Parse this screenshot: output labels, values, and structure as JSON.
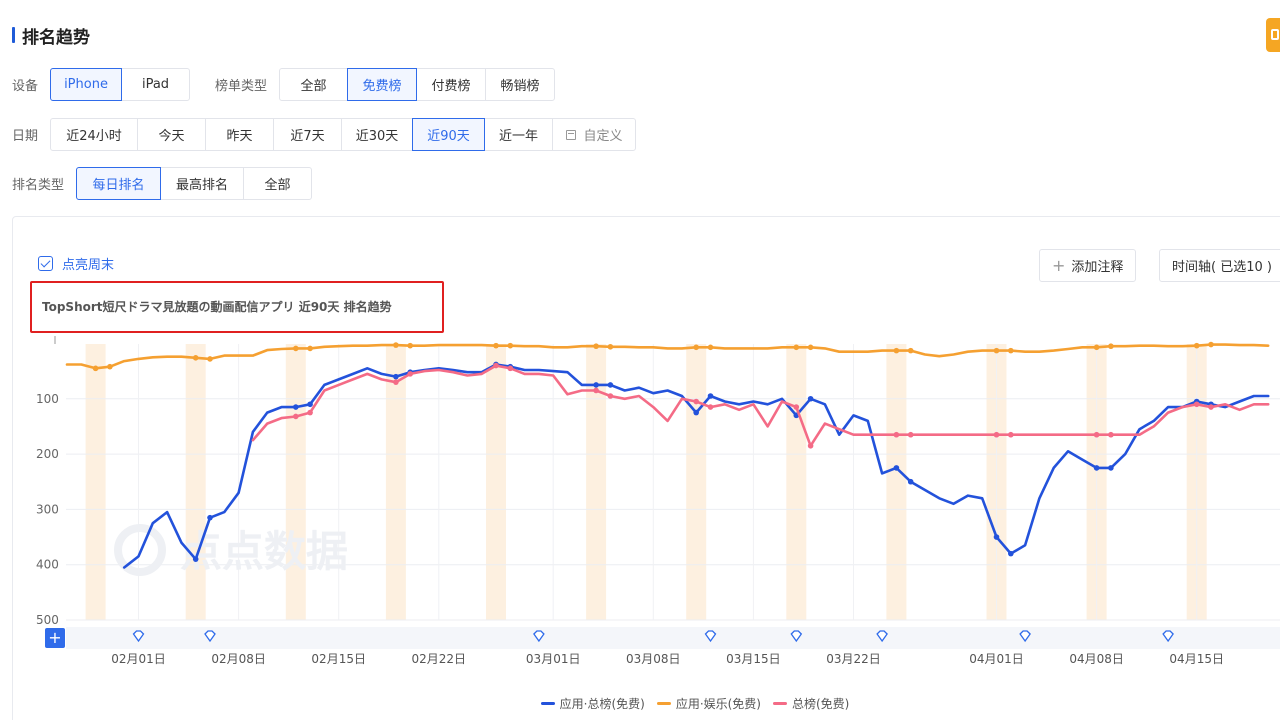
{
  "header": {
    "title": "排名趋势"
  },
  "filters": {
    "device": {
      "label": "设备",
      "options": [
        "iPhone",
        "iPad"
      ],
      "active": 0
    },
    "list_type": {
      "label": "榜单类型",
      "options": [
        "全部",
        "免费榜",
        "付费榜",
        "畅销榜"
      ],
      "active": 1
    },
    "date": {
      "label": "日期",
      "options": [
        "近24小时",
        "今天",
        "昨天",
        "近7天",
        "近30天",
        "近90天",
        "近一年"
      ],
      "custom_label": "自定义",
      "active": 5
    },
    "rank_type": {
      "label": "排名类型",
      "options": [
        "每日排名",
        "最高排名",
        "全部"
      ],
      "active": 0
    }
  },
  "toolbar": {
    "highlight_weekend": "点亮周末",
    "add_note": "添加注释",
    "timeline": "时间轴( 已选10 )"
  },
  "colors": {
    "accent": "#2f6bea",
    "overall": "#2352db",
    "entertainment": "#f5a031",
    "top_chart": "#f46b86",
    "weekend_band": "#fdf0e0",
    "highlight_box": "#e02020"
  },
  "chart_data": {
    "type": "line",
    "title": "TopShort短尺ドラマ見放題の動画配信アプリ 近90天 排名趋势",
    "y_axis": {
      "reversed": true,
      "range": [
        1,
        500
      ],
      "ticks": [
        100,
        200,
        300,
        400,
        500
      ]
    },
    "x_axis": {
      "start": "01-27",
      "end": "04-20",
      "tick_labels": [
        "02月01日",
        "02月08日",
        "02月15日",
        "02月22日",
        "03月01日",
        "03月08日",
        "03月15日",
        "03月22日",
        "04月01日",
        "04月08日",
        "04月15日"
      ],
      "tick_days": [
        5,
        12,
        19,
        26,
        34,
        41,
        48,
        55,
        65,
        72,
        79
      ]
    },
    "weekend_bands_days": [
      2,
      9,
      16,
      23,
      30,
      37,
      44,
      51,
      58,
      65,
      72,
      79
    ],
    "annotation_days": [
      5,
      10,
      33,
      45,
      51,
      57,
      67,
      77
    ],
    "series": [
      {
        "name": "应用·总榜(免费)",
        "color": "#2352db",
        "days": [
          4,
          5,
          6,
          7,
          8,
          9,
          10,
          11,
          12,
          13,
          14,
          15,
          16,
          17,
          18,
          19,
          20,
          21,
          22,
          23,
          24,
          25,
          26,
          27,
          28,
          29,
          30,
          31,
          32,
          33,
          34,
          35,
          36,
          37,
          38,
          39,
          40,
          41,
          42,
          43,
          44,
          45,
          46,
          47,
          48,
          49,
          50,
          51,
          52,
          53,
          54,
          55,
          56,
          57,
          58,
          59,
          60,
          61,
          62,
          63,
          64,
          65,
          66,
          67,
          68,
          69,
          70,
          71,
          72,
          73,
          74,
          75,
          76,
          77,
          78,
          79,
          80,
          81,
          82,
          83,
          84
        ],
        "values": [
          405,
          385,
          325,
          305,
          360,
          390,
          315,
          305,
          270,
          160,
          125,
          115,
          115,
          110,
          75,
          65,
          55,
          45,
          55,
          60,
          52,
          48,
          45,
          48,
          52,
          52,
          38,
          42,
          48,
          48,
          50,
          52,
          75,
          75,
          75,
          85,
          80,
          90,
          85,
          95,
          125,
          95,
          105,
          110,
          105,
          110,
          100,
          130,
          100,
          110,
          165,
          130,
          140,
          235,
          225,
          250,
          265,
          280,
          290,
          275,
          280,
          350,
          380,
          365,
          280,
          225,
          195,
          210,
          225,
          225,
          200,
          155,
          140,
          115,
          115,
          105,
          110,
          115,
          105,
          95,
          95
        ]
      },
      {
        "name": "应用·娱乐(免费)",
        "color": "#f5a031",
        "days": [
          0,
          1,
          2,
          3,
          4,
          5,
          6,
          7,
          8,
          9,
          10,
          11,
          12,
          13,
          14,
          15,
          16,
          17,
          18,
          19,
          20,
          21,
          22,
          23,
          24,
          25,
          26,
          27,
          28,
          29,
          30,
          31,
          32,
          33,
          34,
          35,
          36,
          37,
          38,
          39,
          40,
          41,
          42,
          43,
          44,
          45,
          46,
          47,
          48,
          49,
          50,
          51,
          52,
          53,
          54,
          55,
          56,
          57,
          58,
          59,
          60,
          61,
          62,
          63,
          64,
          65,
          66,
          67,
          68,
          69,
          70,
          71,
          72,
          73,
          74,
          75,
          76,
          77,
          78,
          79,
          80,
          81,
          82,
          83,
          84
        ],
        "values": [
          38,
          38,
          45,
          42,
          32,
          28,
          25,
          24,
          24,
          26,
          28,
          22,
          22,
          22,
          12,
          10,
          9,
          9,
          6,
          5,
          4,
          4,
          3,
          3,
          4,
          4,
          3,
          3,
          3,
          3,
          4,
          4,
          5,
          5,
          7,
          7,
          5,
          5,
          6,
          6,
          7,
          7,
          9,
          9,
          7,
          7,
          9,
          9,
          9,
          9,
          7,
          7,
          7,
          9,
          15,
          15,
          15,
          13,
          13,
          13,
          20,
          23,
          20,
          15,
          13,
          13,
          13,
          15,
          15,
          13,
          10,
          7,
          7,
          5,
          5,
          4,
          4,
          5,
          5,
          4,
          2,
          2,
          3,
          3,
          4
        ]
      },
      {
        "name": "总榜(免费)",
        "color": "#f46b86",
        "days": [
          13,
          14,
          15,
          16,
          17,
          18,
          19,
          20,
          21,
          22,
          23,
          24,
          25,
          26,
          27,
          28,
          29,
          30,
          31,
          32,
          33,
          34,
          35,
          36,
          37,
          38,
          39,
          40,
          41,
          42,
          43,
          44,
          45,
          46,
          47,
          48,
          49,
          50,
          51,
          52,
          53,
          54,
          55,
          56,
          57,
          58,
          59,
          60,
          61,
          62,
          63,
          64,
          65,
          66,
          67,
          68,
          69,
          70,
          71,
          72,
          73,
          74,
          75,
          76,
          77,
          78,
          79,
          80,
          81,
          82,
          83,
          84
        ],
        "values": [
          175,
          145,
          135,
          132,
          125,
          85,
          75,
          65,
          55,
          65,
          70,
          55,
          50,
          48,
          52,
          58,
          55,
          40,
          45,
          55,
          55,
          58,
          92,
          85,
          85,
          95,
          100,
          95,
          115,
          140,
          100,
          105,
          115,
          110,
          120,
          110,
          150,
          105,
          115,
          185,
          145,
          155,
          165,
          165,
          165,
          165,
          165,
          165,
          165,
          165,
          165,
          165,
          165,
          165,
          165,
          165,
          165,
          165,
          165,
          165,
          165,
          165,
          165,
          150,
          125,
          115,
          110,
          115,
          110,
          120,
          110,
          110
        ]
      }
    ]
  }
}
